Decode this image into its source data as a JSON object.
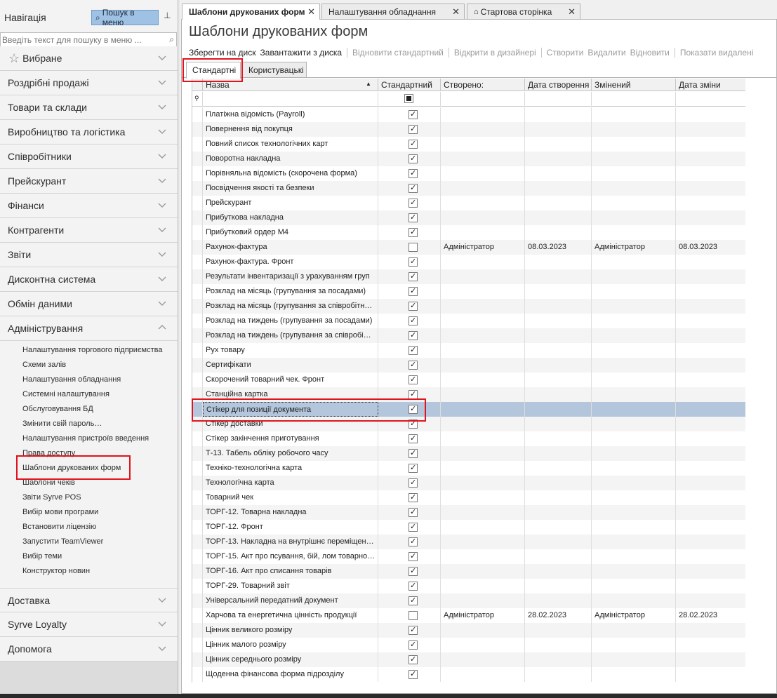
{
  "nav": {
    "title": "Навігація",
    "menu_search_button": "Пошук в меню",
    "search_placeholder": "Введіть текст для пошуку в меню ...",
    "groups": [
      {
        "label": "Вибране"
      },
      {
        "label": "Роздрібні продажі"
      },
      {
        "label": "Товари та склади"
      },
      {
        "label": "Виробництво та логістика"
      },
      {
        "label": "Співробітники"
      },
      {
        "label": "Прейскурант"
      },
      {
        "label": "Фінанси"
      },
      {
        "label": "Контрагенти"
      },
      {
        "label": "Звіти"
      },
      {
        "label": "Дисконтна система"
      },
      {
        "label": "Обмін даними"
      },
      {
        "label": "Адміністрування"
      }
    ],
    "admin_items": [
      "Налаштування торгового підприємства",
      "Схеми залів",
      "Налаштування обладнання",
      "Системні налаштування",
      "Обслуговування БД",
      "Змінити свій пароль…",
      "Налаштування пристроїв введення",
      "Права доступу",
      "Шаблони друкованих форм",
      "Шаблони чеків",
      "Звіти Syrve POS",
      "Вибір мови програми",
      "Встановити ліцензію",
      "Запустити TeamViewer",
      "Вибір теми",
      "Конструктор новин"
    ],
    "bottom_groups": [
      {
        "label": "Доставка"
      },
      {
        "label": "Syrve Loyalty"
      },
      {
        "label": "Допомога"
      }
    ]
  },
  "tabs": [
    {
      "label": "Шаблони друкованих форм"
    },
    {
      "label": "Налаштування обладнання"
    },
    {
      "label": "Стартова сторінка"
    }
  ],
  "page": {
    "title": "Шаблони друкованих форм",
    "toolbar": {
      "save_to_disk": "Зберегти на диск",
      "load_from_disk": "Завантажити з диска",
      "restore_standard": "Відновити стандартний",
      "open_in_designer": "Відкрити в дизайнері",
      "create": "Створити",
      "delete": "Видалити",
      "restore": "Відновити",
      "show_deleted": "Показати видалені"
    },
    "subtabs": [
      "Стандартні",
      "Користувацькі"
    ]
  },
  "grid": {
    "columns": [
      "Назва",
      "Стандартний",
      "Створено:",
      "Дата створення",
      "Змінений",
      "Дата зміни"
    ],
    "rows": [
      {
        "name": "Платіжна відомість (Payroll)",
        "standard": true,
        "created_by": "",
        "created_date": "",
        "modified_by": "",
        "modified_date": ""
      },
      {
        "name": "Повернення від покупця",
        "standard": true,
        "created_by": "",
        "created_date": "",
        "modified_by": "",
        "modified_date": ""
      },
      {
        "name": "Повний список технологічних карт",
        "standard": true,
        "created_by": "",
        "created_date": "",
        "modified_by": "",
        "modified_date": ""
      },
      {
        "name": "Поворотна накладна",
        "standard": true,
        "created_by": "",
        "created_date": "",
        "modified_by": "",
        "modified_date": ""
      },
      {
        "name": "Порівняльна відомість (скорочена форма)",
        "standard": true,
        "created_by": "",
        "created_date": "",
        "modified_by": "",
        "modified_date": ""
      },
      {
        "name": "Посвідчення якості та безпеки",
        "standard": true,
        "created_by": "",
        "created_date": "",
        "modified_by": "",
        "modified_date": ""
      },
      {
        "name": "Прейскурант",
        "standard": true,
        "created_by": "",
        "created_date": "",
        "modified_by": "",
        "modified_date": ""
      },
      {
        "name": "Прибуткова накладна",
        "standard": true,
        "created_by": "",
        "created_date": "",
        "modified_by": "",
        "modified_date": ""
      },
      {
        "name": "Прибутковий ордер М4",
        "standard": true,
        "created_by": "",
        "created_date": "",
        "modified_by": "",
        "modified_date": ""
      },
      {
        "name": "Рахунок-фактура",
        "standard": false,
        "created_by": "Адміністратор",
        "created_date": "08.03.2023",
        "modified_by": "Адміністратор",
        "modified_date": "08.03.2023"
      },
      {
        "name": "Рахунок-фактура. Фронт",
        "standard": true,
        "created_by": "",
        "created_date": "",
        "modified_by": "",
        "modified_date": ""
      },
      {
        "name": "Результати інвентаризації з урахуванням груп",
        "standard": true,
        "created_by": "",
        "created_date": "",
        "modified_by": "",
        "modified_date": ""
      },
      {
        "name": "Розклад на місяць (групування за посадами)",
        "standard": true,
        "created_by": "",
        "created_date": "",
        "modified_by": "",
        "modified_date": ""
      },
      {
        "name": "Розклад на місяць (групування за співробітн…",
        "standard": true,
        "created_by": "",
        "created_date": "",
        "modified_by": "",
        "modified_date": ""
      },
      {
        "name": "Розклад на тиждень (групування за посадами)",
        "standard": true,
        "created_by": "",
        "created_date": "",
        "modified_by": "",
        "modified_date": ""
      },
      {
        "name": "Розклад на тиждень (групування за співробі…",
        "standard": true,
        "created_by": "",
        "created_date": "",
        "modified_by": "",
        "modified_date": ""
      },
      {
        "name": "Рух товару",
        "standard": true,
        "created_by": "",
        "created_date": "",
        "modified_by": "",
        "modified_date": ""
      },
      {
        "name": "Сертифікати",
        "standard": true,
        "created_by": "",
        "created_date": "",
        "modified_by": "",
        "modified_date": ""
      },
      {
        "name": "Скорочений товарний чек. Фронт",
        "standard": true,
        "created_by": "",
        "created_date": "",
        "modified_by": "",
        "modified_date": ""
      },
      {
        "name": "Станційна картка",
        "standard": true,
        "created_by": "",
        "created_date": "",
        "modified_by": "",
        "modified_date": ""
      },
      {
        "name": "Стікер для позиції документа",
        "standard": true,
        "created_by": "",
        "created_date": "",
        "modified_by": "",
        "modified_date": "",
        "selected": true
      },
      {
        "name": "Стікер доставки",
        "standard": true,
        "created_by": "",
        "created_date": "",
        "modified_by": "",
        "modified_date": ""
      },
      {
        "name": "Стікер закінчення приготування",
        "standard": true,
        "created_by": "",
        "created_date": "",
        "modified_by": "",
        "modified_date": ""
      },
      {
        "name": "Т-13. Табель обліку робочого часу",
        "standard": true,
        "created_by": "",
        "created_date": "",
        "modified_by": "",
        "modified_date": ""
      },
      {
        "name": "Техніко-технологічна карта",
        "standard": true,
        "created_by": "",
        "created_date": "",
        "modified_by": "",
        "modified_date": ""
      },
      {
        "name": "Технологічна карта",
        "standard": true,
        "created_by": "",
        "created_date": "",
        "modified_by": "",
        "modified_date": ""
      },
      {
        "name": "Товарний чек",
        "standard": true,
        "created_by": "",
        "created_date": "",
        "modified_by": "",
        "modified_date": ""
      },
      {
        "name": "ТОРГ-12. Товарна накладна",
        "standard": true,
        "created_by": "",
        "created_date": "",
        "modified_by": "",
        "modified_date": ""
      },
      {
        "name": "ТОРГ-12. Фронт",
        "standard": true,
        "created_by": "",
        "created_date": "",
        "modified_by": "",
        "modified_date": ""
      },
      {
        "name": "ТОРГ-13. Накладна на внутрішнє переміщенн…",
        "standard": true,
        "created_by": "",
        "created_date": "",
        "modified_by": "",
        "modified_date": ""
      },
      {
        "name": "ТОРГ-15. Акт про псування, бій, лом товарно…",
        "standard": true,
        "created_by": "",
        "created_date": "",
        "modified_by": "",
        "modified_date": ""
      },
      {
        "name": "ТОРГ-16. Акт про списання товарів",
        "standard": true,
        "created_by": "",
        "created_date": "",
        "modified_by": "",
        "modified_date": ""
      },
      {
        "name": "ТОРГ-29. Товарний звіт",
        "standard": true,
        "created_by": "",
        "created_date": "",
        "modified_by": "",
        "modified_date": ""
      },
      {
        "name": "Універсальний передатний документ",
        "standard": true,
        "created_by": "",
        "created_date": "",
        "modified_by": "",
        "modified_date": ""
      },
      {
        "name": "Харчова та енергетична цінність продукції",
        "standard": false,
        "created_by": "Адміністратор",
        "created_date": "28.02.2023",
        "modified_by": "Адміністратор",
        "modified_date": "28.02.2023"
      },
      {
        "name": "Цінник великого розміру",
        "standard": true,
        "created_by": "",
        "created_date": "",
        "modified_by": "",
        "modified_date": ""
      },
      {
        "name": "Цінник малого розміру",
        "standard": true,
        "created_by": "",
        "created_date": "",
        "modified_by": "",
        "modified_date": ""
      },
      {
        "name": "Цінник середнього розміру",
        "standard": true,
        "created_by": "",
        "created_date": "",
        "modified_by": "",
        "modified_date": ""
      },
      {
        "name": "Щоденна фінансова форма підрозділу",
        "standard": true,
        "created_by": "",
        "created_date": "",
        "modified_by": "",
        "modified_date": ""
      }
    ]
  },
  "colors": {
    "highlight": "#e0141e",
    "selection": "#b3c6dc",
    "menu_search_button": "#9fc1e3"
  }
}
